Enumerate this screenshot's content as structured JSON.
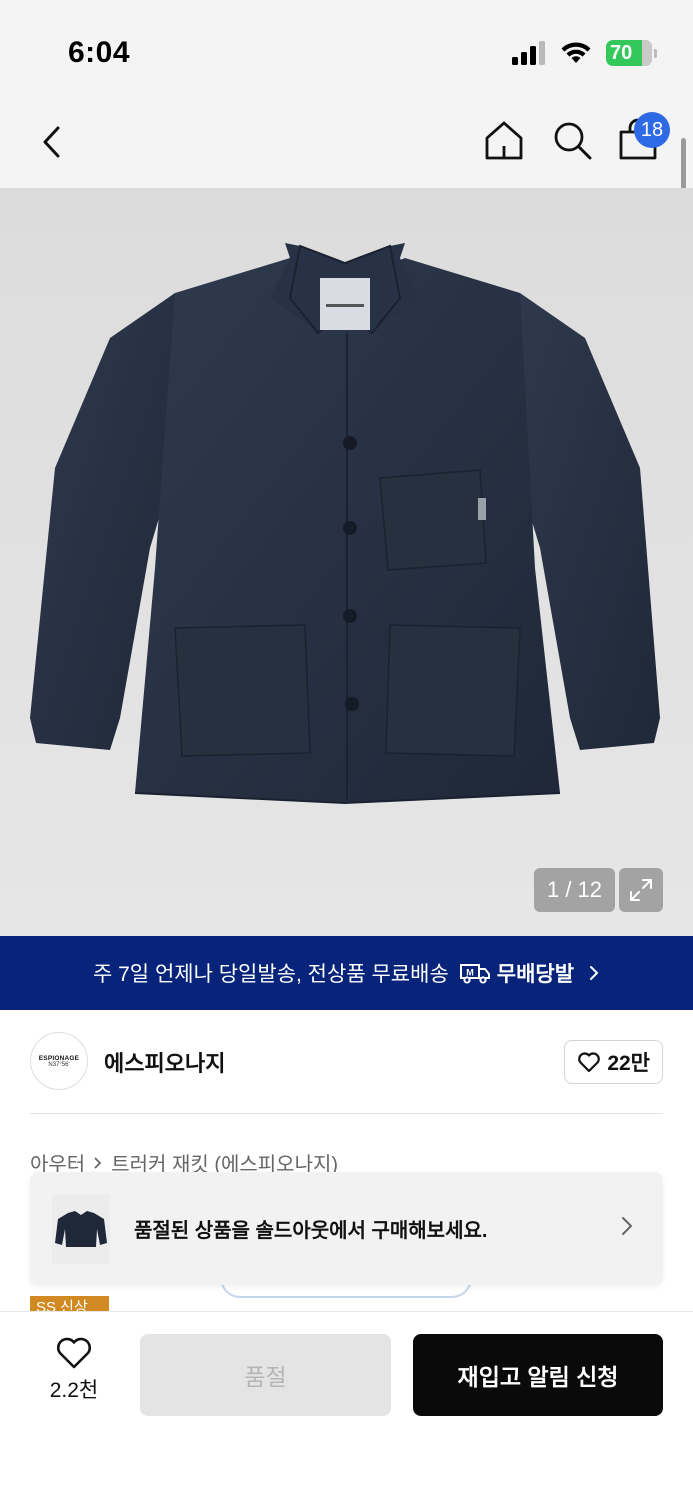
{
  "status_bar": {
    "time": "6:04",
    "battery_level": "70",
    "battery_color": "#34c759"
  },
  "nav": {
    "cart_count": "18",
    "badge_color": "#2f6ae6"
  },
  "gallery": {
    "counter": "1 / 12",
    "current": 1,
    "total": 12
  },
  "shipping_banner": {
    "text": "주 7일 언제나 당일발송, 전상품 무료배송",
    "brand_label": "무배당발",
    "background": "#08247a"
  },
  "brand": {
    "logo_line1": "ESPIONAGE",
    "logo_line2": "N37°56'",
    "name": "에스피오나지",
    "likes": "22만"
  },
  "breadcrumb": {
    "category": "아우터",
    "product": "트러커 재킷 (에스피오나지)"
  },
  "soldout_promo": {
    "text": "품절된 상품을 솔드아웃에서 구매해보세요."
  },
  "season_tag": {
    "label": "SS 신상",
    "color": "#d18a21"
  },
  "bottom_bar": {
    "wish_count": "2.2천",
    "soldout_label": "품절",
    "restock_label": "재입고 알림 신청"
  }
}
